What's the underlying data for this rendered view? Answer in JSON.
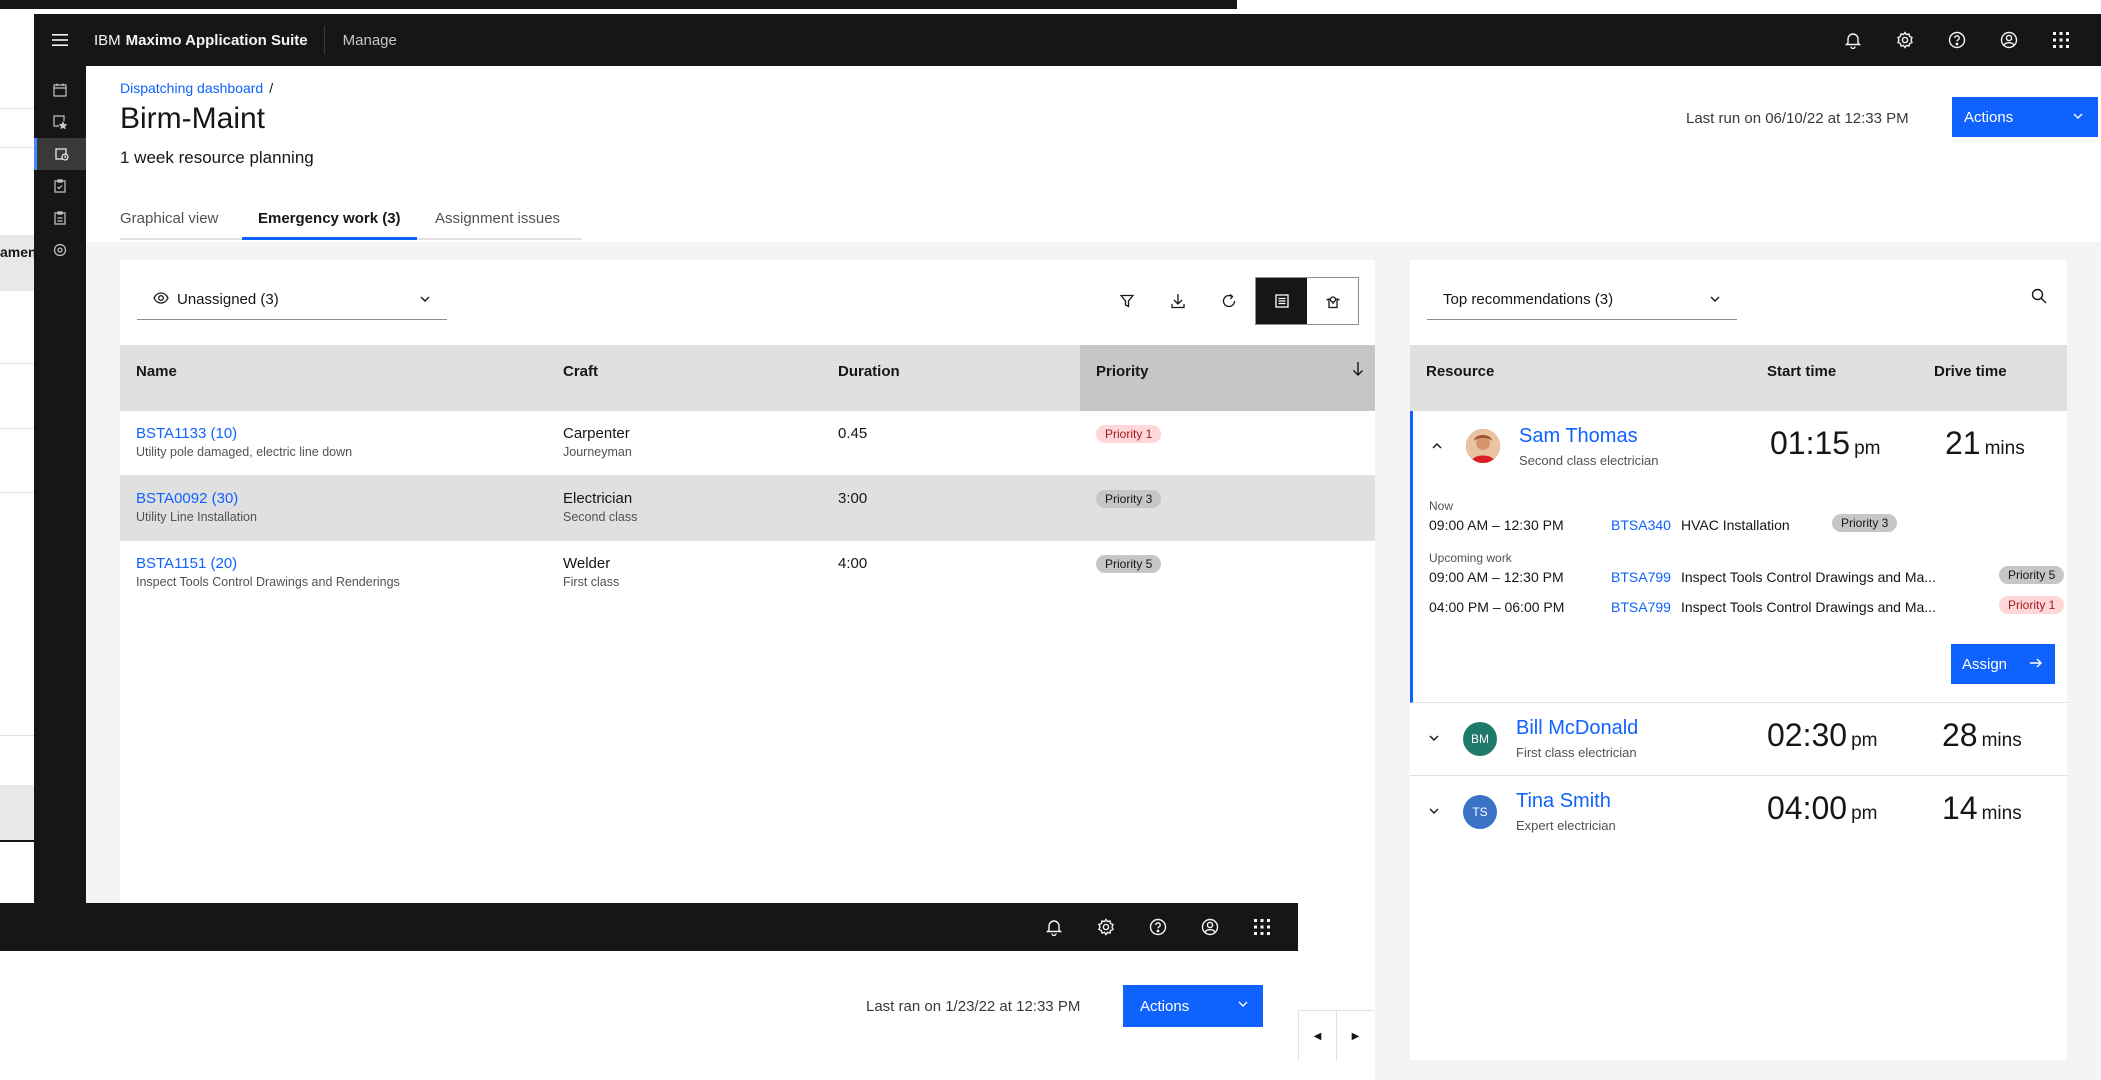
{
  "background": {
    "cutoff_text": "amen"
  },
  "header": {
    "brand_prefix": "IBM",
    "brand_name": "Maximo Application Suite",
    "product": "Manage"
  },
  "page": {
    "breadcrumb": "Dispatching dashboard",
    "breadcrumb_sep": "/",
    "title": "Birm-Maint",
    "subtitle": "1 week resource planning",
    "last_run": "Last run on 06/10/22 at 12:33 PM",
    "actions_label": "Actions"
  },
  "tabs": [
    {
      "label": "Graphical view"
    },
    {
      "label": "Emergency work (3)"
    },
    {
      "label": "Assignment issues"
    }
  ],
  "workpanel": {
    "filter_label": "Unassigned (3)",
    "columns": [
      "Name",
      "Craft",
      "Duration",
      "Priority"
    ],
    "rows": [
      {
        "id": "BSTA1133 (10)",
        "desc": "Utility pole damaged, electric line down",
        "craft": "Carpenter",
        "level": "Journeyman",
        "duration": "0.45",
        "priority": "Priority 1"
      },
      {
        "id": "BSTA0092 (30)",
        "desc": "Utility Line Installation",
        "craft": "Electrician",
        "level": "Second class",
        "duration": "3:00",
        "priority": "Priority 3"
      },
      {
        "id": "BSTA1151 (20)",
        "desc": "Inspect Tools Control Drawings and Renderings",
        "craft": "Welder",
        "level": "First class",
        "duration": "4:00",
        "priority": "Priority 5"
      }
    ]
  },
  "recommendations": {
    "filter_label": "Top recommendations (3)",
    "columns": [
      "Resource",
      "Start time",
      "Drive time"
    ],
    "people": [
      {
        "name": "Sam Thomas",
        "role": "Second class electrician",
        "start": "01:15",
        "start_suffix": "pm",
        "drive": "21",
        "drive_suffix": "mins",
        "initials": ""
      },
      {
        "name": "Bill McDonald",
        "role": "First class electrician",
        "start": "02:30",
        "start_suffix": "pm",
        "drive": "28",
        "drive_suffix": "mins",
        "initials": "BM"
      },
      {
        "name": "Tina Smith",
        "role": "Expert electrician",
        "start": "04:00",
        "start_suffix": "pm",
        "drive": "14",
        "drive_suffix": "mins",
        "initials": "TS"
      }
    ],
    "now_label": "Now",
    "now_slot": {
      "time": "09:00 AM – 12:30 PM",
      "code": "BTSA340",
      "desc": "HVAC Installation",
      "priority": "Priority 3"
    },
    "upcoming_label": "Upcoming work",
    "upcoming_slots": [
      {
        "time": "09:00 AM – 12:30 PM",
        "code": "BTSA799",
        "desc": "Inspect Tools Control Drawings and Ma...",
        "priority": "Priority 5"
      },
      {
        "time": "04:00 PM – 06:00 PM",
        "code": "BTSA799",
        "desc": "Inspect Tools Control Drawings and Ma...",
        "priority": "Priority 1"
      }
    ],
    "assign_label": "Assign"
  },
  "foreground": {
    "last_run": "Last ran on 1/23/22 at 12:33 PM",
    "actions_label": "Actions"
  },
  "colors": {
    "accent": "#0f62fe",
    "shell": "#161616"
  }
}
